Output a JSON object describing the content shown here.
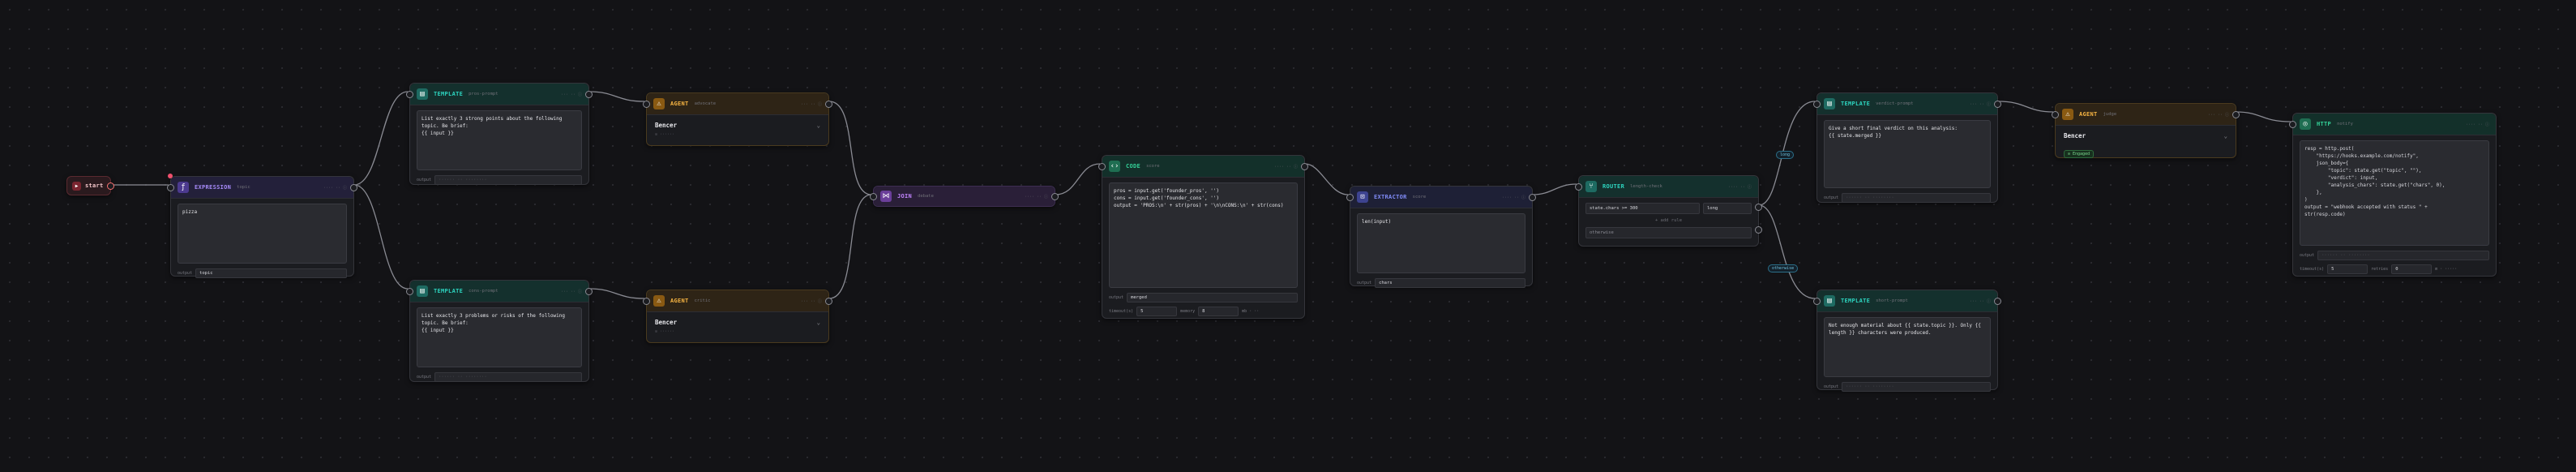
{
  "colors": {
    "template": "#2dd4bf",
    "expression": "#a78bfa",
    "agent": "#f59e0b",
    "join": "#c084fc",
    "code": "#34d399",
    "extractor": "#818cf8",
    "router": "#2dd4bf",
    "http": "#34d399",
    "start": "#f87171"
  },
  "start": {
    "label": "start"
  },
  "expression": {
    "title": "EXPRESSION",
    "kind": "topic",
    "meta": "···· ·· ⓘ",
    "body": "pizza",
    "output_label": "output",
    "output_value": "topic"
  },
  "template_a": {
    "title": "TEMPLATE",
    "kind": "pros-prompt",
    "meta": "··· ·· ⓘ",
    "body": "List exactly 3 strong points about the following\ntopic. Be brief:\n{{ input }}",
    "output_label": "output",
    "output_value": "······ ·· ········"
  },
  "template_b": {
    "title": "TEMPLATE",
    "kind": "cons-prompt",
    "meta": "··· ·· ⓘ",
    "body": "List exactly 3 problems or risks of the following\ntopic. Be brief:\n{{ input }}",
    "output_label": "output",
    "output_value": "······ ·· ········"
  },
  "agent_a": {
    "title": "AGENT",
    "kind": "advocate",
    "meta": "··· ·· ⓘ",
    "name": "Bencer",
    "sub": "⊙ ······"
  },
  "agent_b": {
    "title": "AGENT",
    "kind": "critic",
    "meta": "··· ·· ⓘ",
    "name": "Bencer",
    "sub": "⊙ ······"
  },
  "join": {
    "title": "JOIN",
    "kind": "debate",
    "meta": "···· ·· ⓘ"
  },
  "code": {
    "title": "CODE",
    "kind": "score",
    "meta": "···· ·· ⓘ",
    "body": "pros = input.get('founder_pros', '')\ncons = input.get('founder_cons', '')\noutput = 'PROS:\\n' + str(pros) + '\\n\\nCONS:\\n' + str(cons)",
    "output_label": "output",
    "output_value": "merged",
    "timeout_label": "timeout(s)",
    "timeout_value": "5",
    "memory_label": "memory",
    "memory_value": "8",
    "hint": "mb · ··"
  },
  "extractor": {
    "title": "EXTRACTOR",
    "kind": "score",
    "meta": "···· ·· ⓘ",
    "body": "len(input)",
    "output_label": "output",
    "output_value": "chars"
  },
  "router": {
    "title": "ROUTER",
    "kind": "length-check",
    "meta": "···· ·· ⓘ",
    "cond": "state.chars >= 300",
    "cond_label": "long",
    "add": "+ add rule",
    "otherwise": "otherwise"
  },
  "template_c": {
    "title": "TEMPLATE",
    "kind": "verdict-prompt",
    "meta": "··· ·· ⓘ",
    "body": "Give a short final verdict on this analysis:\n{{ state.merged }}",
    "output_label": "output",
    "output_value": "······ ·· ········"
  },
  "template_d": {
    "title": "TEMPLATE",
    "kind": "short-prompt",
    "meta": "··· ·· ⓘ",
    "body": "Not enough material about {{ state.topic }}. Only {{\nlength }} characters were produced.",
    "output_label": "output",
    "output_value": "······ ·· ········"
  },
  "agent_c": {
    "title": "AGENT",
    "kind": "judge",
    "meta": "··· ·· ⓘ",
    "name": "Bencer",
    "badge": "⊙ Engaged"
  },
  "http": {
    "title": "HTTP",
    "kind": "notify",
    "meta": "···· ·· ⓘ",
    "body": "resp = http.post(\n    \"https://hooks.example.com/notify\",\n    json_body={\n        \"topic\": state.get(\"topic\", \"\"),\n        \"verdict\": input,\n        \"analysis_chars\": state.get(\"chars\", 0),\n    },\n)\noutput = \"webhook accepted with status \" +\nstr(resp.code)",
    "output_label": "output",
    "output_value": "······ ·· ········",
    "timeout_label": "timeout(s)",
    "timeout_value": "5",
    "retries_label": "retries",
    "retries_value": "0",
    "hint": "m · ·····"
  },
  "edge_labels": {
    "long": "long",
    "otherwise": "otherwise"
  }
}
